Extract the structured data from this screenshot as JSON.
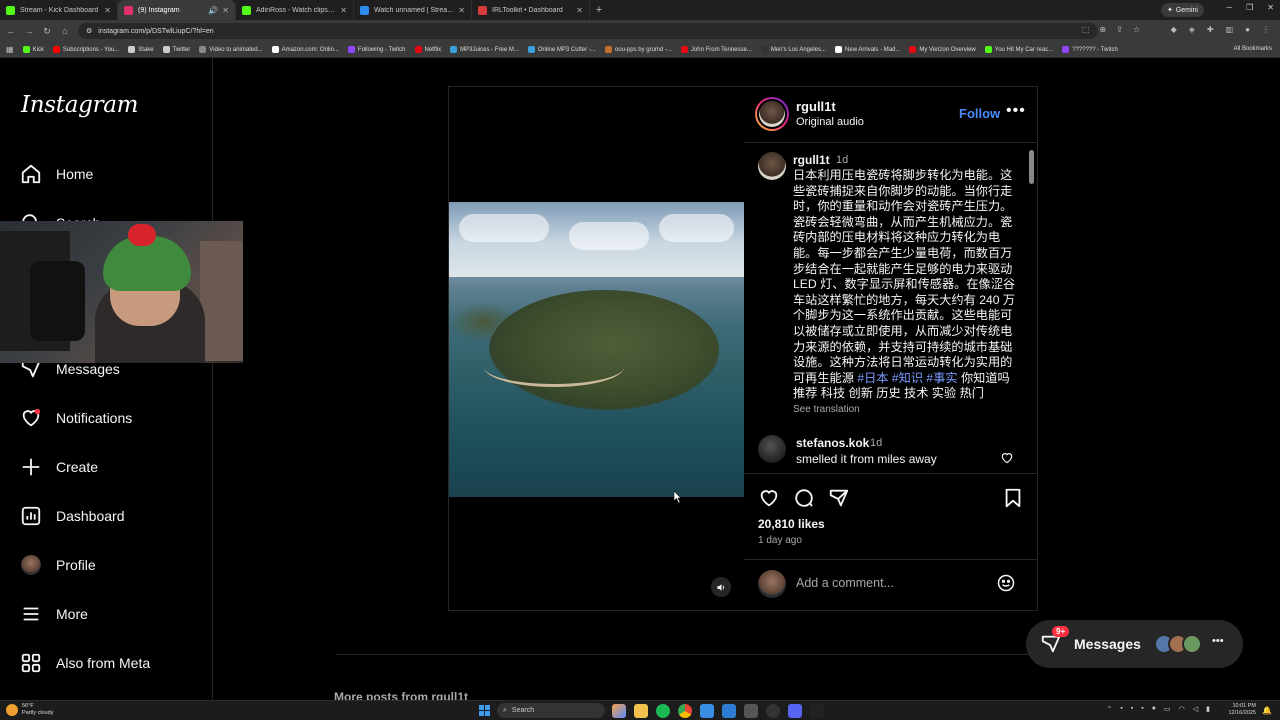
{
  "browser": {
    "tabs": [
      {
        "label": "Stream - Kick Dashboard",
        "color": "#53fc18"
      },
      {
        "label": "(9) Instagram",
        "color": "#e1306c"
      },
      {
        "label": "AdinRoss - Watch clips on Kick",
        "color": "#53fc18"
      },
      {
        "label": "Watch unnamed | Streamable",
        "color": "#2d8cf0"
      },
      {
        "label": "IRLToolkit • Dashboard",
        "color": "#d83b3b"
      }
    ],
    "gemini_label": "Gemini",
    "url": "instagram.com/p/DSTwlLiupC/?hl=en",
    "bookmarks": [
      {
        "label": "Kick",
        "color": "#53fc18"
      },
      {
        "label": "Subscriptions - You...",
        "color": "#ff0000"
      },
      {
        "label": "Stake",
        "color": "#cccccc"
      },
      {
        "label": "Twitter",
        "color": "#cccccc"
      },
      {
        "label": "Video to animated...",
        "color": "#888888"
      },
      {
        "label": "Amazon.com: Onlin...",
        "color": "#ffffff"
      },
      {
        "label": "Following - Twitch",
        "color": "#9146ff"
      },
      {
        "label": "Netflix",
        "color": "#e50914"
      },
      {
        "label": "MP3Juices - Free M...",
        "color": "#3aa0d8"
      },
      {
        "label": "Online MP3 Cutter -...",
        "color": "#3aa0d8"
      },
      {
        "label": "oou-pps by grumd -...",
        "color": "#c0712f"
      },
      {
        "label": "John From Tennesse...",
        "color": "#e50914"
      },
      {
        "label": "Men's Los Angeles...",
        "color": "#333333"
      },
      {
        "label": "New Arrivals - Mad...",
        "color": "#ffffff"
      },
      {
        "label": "My Verizon Overview",
        "color": "#e50914"
      },
      {
        "label": "You Hit My Car reac...",
        "color": "#53fc18"
      },
      {
        "label": "??????? - Twitch",
        "color": "#9146ff"
      }
    ],
    "all_bookmarks": "All Bookmarks"
  },
  "instagram": {
    "logo": "Instagram",
    "nav": {
      "home": "Home",
      "search": "Search",
      "messages": "Messages",
      "notifications": "Notifications",
      "create": "Create",
      "dashboard": "Dashboard",
      "profile": "Profile",
      "more": "More",
      "also_from_meta": "Also from Meta"
    },
    "post": {
      "username": "rgull1t",
      "audio": "Original audio",
      "follow": "Follow",
      "caption_user": "rgull1t",
      "caption_time": "1d",
      "caption_text": "日本利用压电瓷砖将脚步转化为电能。这些瓷砖捕捉来自你脚步的动能。当你行走时，你的重量和动作会对瓷砖产生压力。瓷砖会轻微弯曲，从而产生机械应力。瓷砖内部的压电材料将这种应力转化为电能。每一步都会产生少量电荷，而数百万步结合在一起就能产生足够的电力来驱动 LED 灯、数字显示屏和传感器。在像涩谷车站这样繁忙的地方，每天大约有 240 万个脚步为这一系统作出贡献。这些电能可以被储存或立即使用，从而减少对传统电力来源的依赖，并支持可持续的城市基础设施。这种方法将日常运动转化为实用的可再生能源 ",
      "hashtags": "#日本 #知识 #事实",
      "caption_tail": " 你知道吗 推荐 科技 创新 历史 技术 实验 热门",
      "see_translation": "See translation",
      "comment_user": "stefanos.kok",
      "comment_time": "1d",
      "comment_text": "smelled it from miles away",
      "likes": "20,810 likes",
      "ago": "1 day ago",
      "comment_placeholder": "Add a comment..."
    },
    "more_from": "More posts from rgull1t",
    "messages_pill": {
      "badge": "9+",
      "label": "Messages"
    }
  },
  "taskbar": {
    "weather_temp": "56°F",
    "weather_desc": "Partly cloudy",
    "search": "Search",
    "time": "10:01 PM",
    "date": "12/16/2025"
  }
}
